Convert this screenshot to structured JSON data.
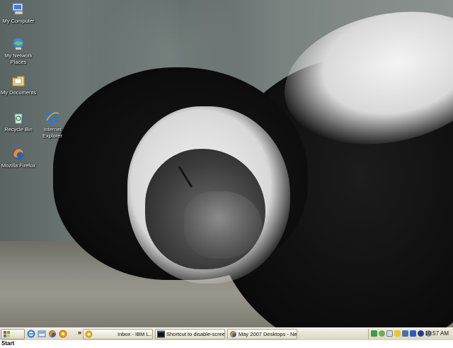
{
  "desktop": {
    "icons": [
      {
        "label": "My Computer",
        "icon": "my-computer-icon"
      },
      {
        "label": "My Network Places",
        "icon": "network-places-icon"
      },
      {
        "label": "My Documents",
        "icon": "my-documents-icon"
      },
      {
        "label": "Recycle Bin",
        "icon": "recycle-bin-icon"
      },
      {
        "label": "Internet Explorer",
        "icon": "internet-explorer-icon"
      },
      {
        "label": "Mozilla Firefox",
        "icon": "firefox-icon"
      }
    ]
  },
  "taskbar": {
    "start_label": "Start",
    "quick_launch": [
      "internet-explorer-icon",
      "show-desktop-icon",
      "firefox-icon",
      "media-icon",
      "chevron-icon"
    ],
    "overflow_label": "»",
    "tasks": [
      {
        "label": "Inbox - IBM L...",
        "icon": "lotus-notes-icon"
      },
      {
        "label": "Shortcut to disable-scree...",
        "icon": "command-prompt-icon"
      },
      {
        "label": "May 2007 Desktops - Ne...",
        "icon": "firefox-icon"
      }
    ],
    "tray_icons": [
      "network-icon",
      "security-icon",
      "sync-icon",
      "messenger-icon",
      "audio-icon",
      "display-icon",
      "media-player-icon",
      "power-icon"
    ],
    "clock": "10:57 AM"
  },
  "colors": {
    "taskbar_bg": "#e6e2d2",
    "desktop_text": "#ffffff"
  }
}
